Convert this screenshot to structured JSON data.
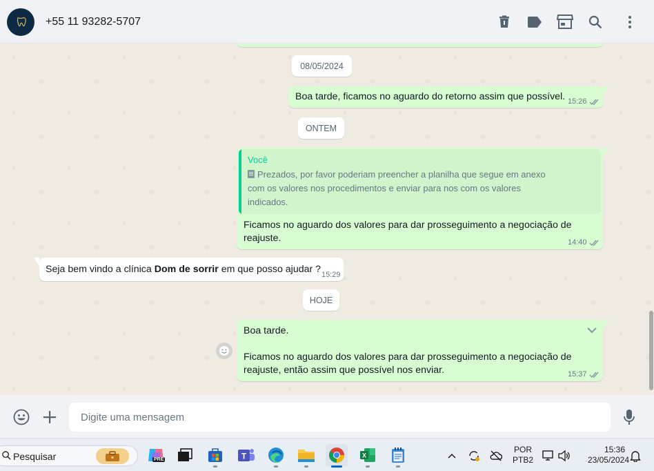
{
  "header": {
    "contact_name": "+55 11 93282-5707",
    "icons": [
      "delete-icon",
      "label-icon",
      "store-icon",
      "search-icon",
      "menu-icon"
    ]
  },
  "chat": {
    "date_chips": {
      "first": "08/05/2024",
      "second": "ONTEM",
      "third": "HOJE"
    },
    "messages": [
      {
        "dir": "out",
        "text": "Boa tarde, ficamos no aguardo do retorno assim que possível.",
        "time": "15:26",
        "status": "read"
      },
      {
        "dir": "out",
        "quote_author": "Você",
        "quote_text": "Prezados, por favor poderiam preencher a planilha que segue em anexo com os valores nos procedimentos e enviar para nos com os valores indicados.",
        "text": "Ficamos no aguardo dos valores para dar prosseguimento a negociação de reajuste.",
        "time": "14:40",
        "status": "read"
      },
      {
        "dir": "in",
        "text_before": "Seja bem vindo a clínica ",
        "text_bold": "Dom de sorrir",
        "text_after": " em que posso ajudar ?",
        "time": "15:29"
      },
      {
        "dir": "out",
        "line1": "Boa tarde.",
        "line2": "Ficamos no aguardo dos valores para dar prosseguimento a negociação de reajuste, então assim que possível nos enviar.",
        "time": "15:37",
        "status": "read"
      }
    ]
  },
  "composer": {
    "placeholder": "Digite uma mensagem",
    "icons": [
      "emoji-icon",
      "attach-icon",
      "microphone-icon"
    ]
  },
  "taskbar": {
    "search_placeholder": "Pesquisar",
    "copilot_badge": "PRE",
    "lang_top": "POR",
    "lang_bottom": "PTB2",
    "time": "15:36",
    "date": "23/05/2024",
    "apps": [
      "copilot",
      "task-view",
      "microsoft-store",
      "teams",
      "edge",
      "file-explorer",
      "chrome",
      "excel",
      "notepad"
    ],
    "active_app": "chrome"
  },
  "colors": {
    "outgoing_bubble": "#d9fdd3",
    "incoming_bubble": "#ffffff",
    "accent": "#06cf9c",
    "read_ticks": "#8696a0"
  }
}
